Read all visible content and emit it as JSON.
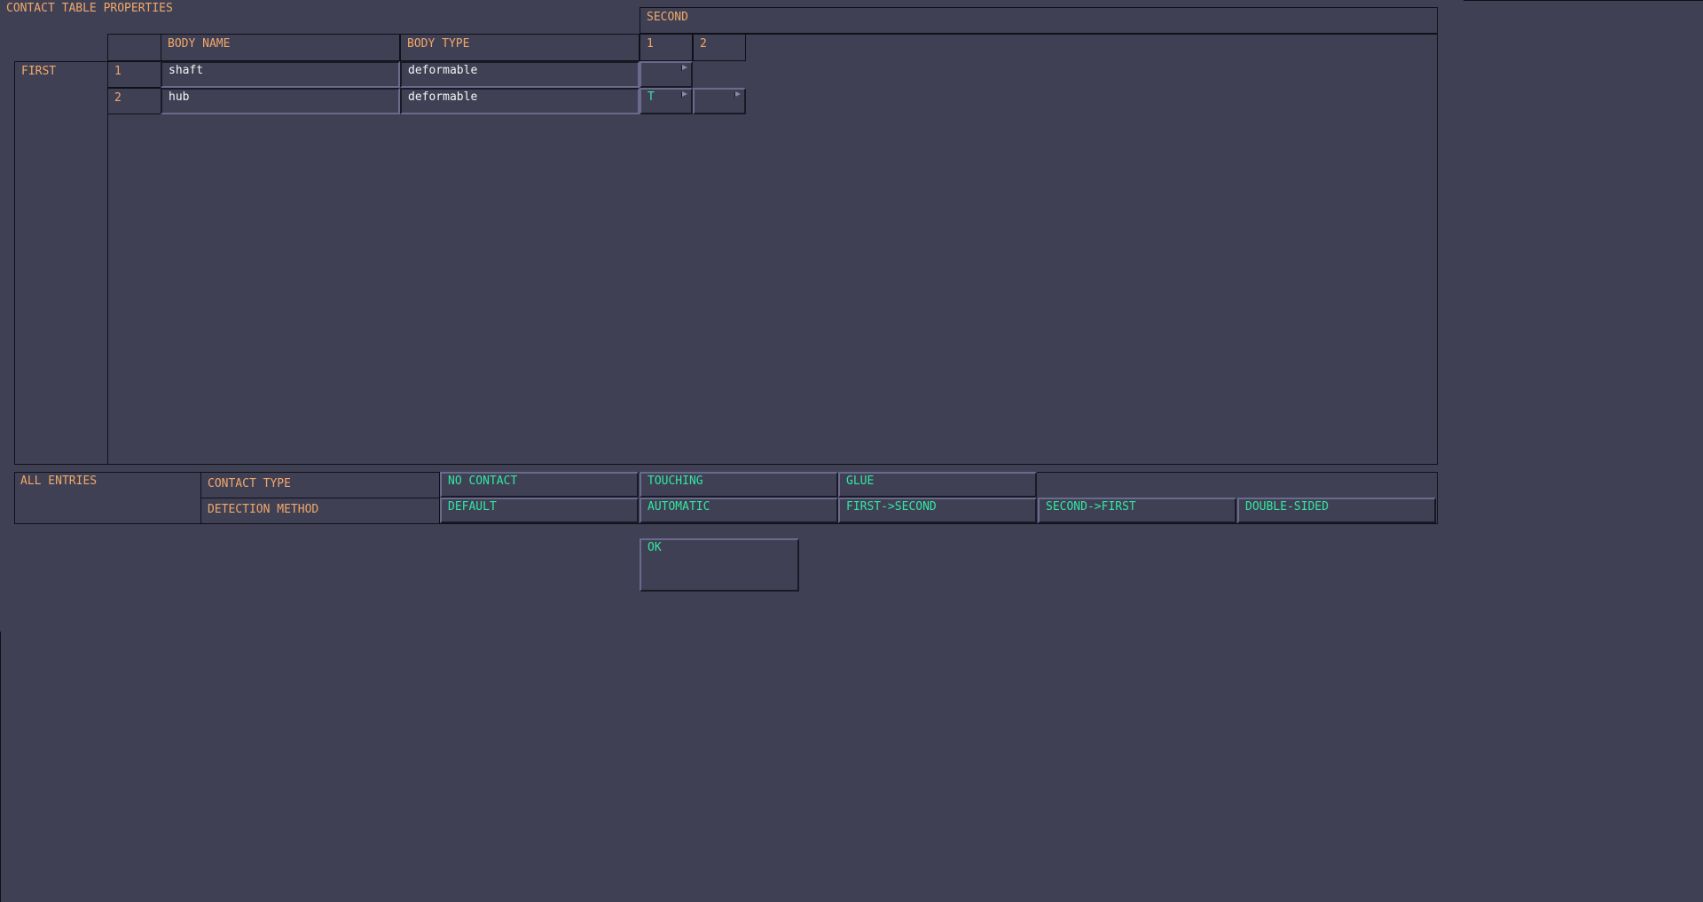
{
  "title": "CONTACT TABLE PROPERTIES",
  "table": {
    "second_label": "SECOND",
    "first_label": "FIRST",
    "col_body_name": "BODY NAME",
    "col_body_type": "BODY TYPE",
    "second_cols": [
      "1",
      "2"
    ],
    "rows": [
      {
        "index": "1",
        "body_name": "shaft",
        "body_type": "deformable",
        "cells": [
          ""
        ]
      },
      {
        "index": "2",
        "body_name": "hub",
        "body_type": "deformable",
        "cells": [
          "T",
          ""
        ]
      }
    ]
  },
  "all_entries": {
    "label": "ALL ENTRIES",
    "contact_type_label": "CONTACT TYPE",
    "contact_type_options": [
      "NO CONTACT",
      "TOUCHING",
      "GLUE"
    ],
    "detection_method_label": "DETECTION METHOD",
    "detection_method_options": [
      "DEFAULT",
      "AUTOMATIC",
      "FIRST->SECOND",
      "SECOND->FIRST",
      "DOUBLE-SIDED"
    ]
  },
  "ok_label": "OK"
}
